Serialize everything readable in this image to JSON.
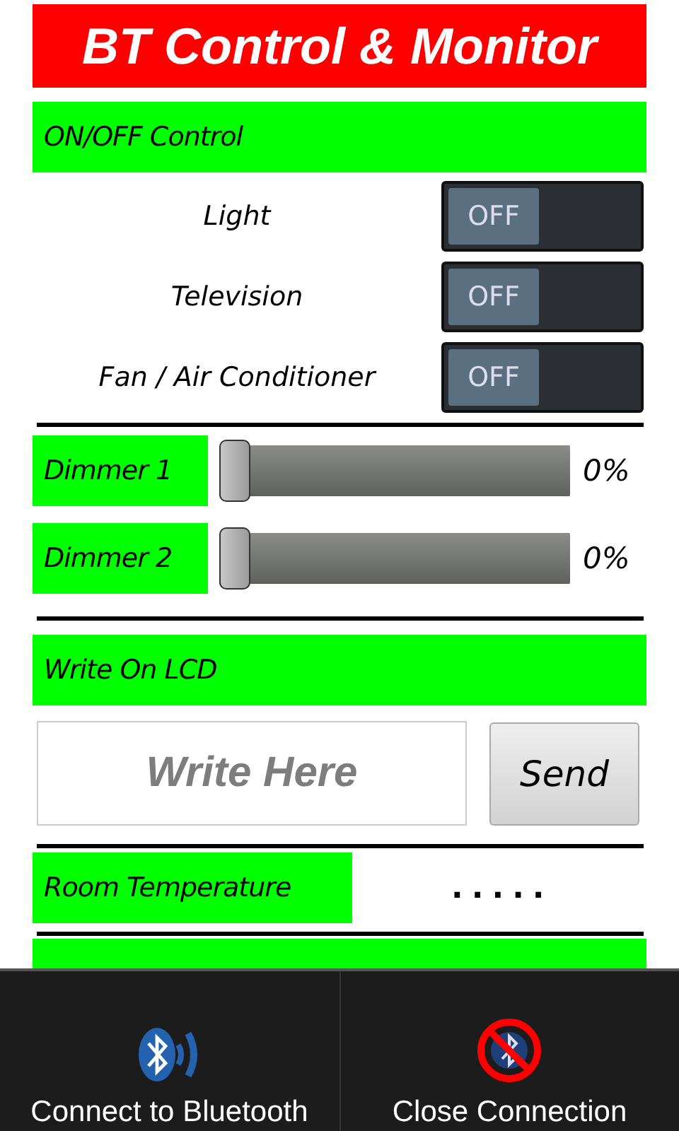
{
  "title": "BT Control & Monitor",
  "onoff": {
    "header": "ON/OFF Control",
    "items": [
      {
        "label": "Light",
        "state": "OFF",
        "on": false
      },
      {
        "label": "Television",
        "state": "OFF",
        "on": false
      },
      {
        "label": "Fan / Air Conditioner",
        "state": "OFF",
        "on": false
      }
    ]
  },
  "dimmers": [
    {
      "label": "Dimmer 1",
      "level": 0,
      "reading": "0%"
    },
    {
      "label": "Dimmer 2",
      "level": 0,
      "reading": "0%"
    }
  ],
  "lcd": {
    "header": "Write On LCD",
    "placeholder": "Write Here",
    "button": "Send"
  },
  "temperature": {
    "label": "Room Temperature",
    "reading": "....."
  },
  "switches": {
    "kind": "header-bar"
  },
  "actions": [
    {
      "kind": "connect",
      "label": "Connect to Bluetooth"
    },
    {
      "kind": "close",
      "label": "Close Connection"
    }
  ]
}
